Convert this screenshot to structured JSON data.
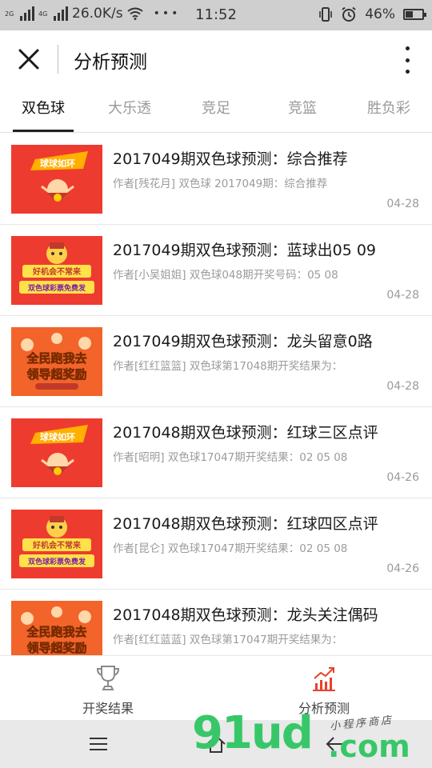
{
  "status_bar": {
    "network_type_top": "4G",
    "network_type_bottom": "2G",
    "speed": "26.0K/s",
    "dots": "•••",
    "time": "11:52",
    "battery": "46%",
    "battery_level": 0.46
  },
  "header": {
    "title": "分析预测",
    "close_icon": "close-icon",
    "more_icon": "more-vertical-icon"
  },
  "tabs": [
    {
      "label": "双色球",
      "active": true
    },
    {
      "label": "大乐透",
      "active": false
    },
    {
      "label": "竞足",
      "active": false
    },
    {
      "label": "竞篮",
      "active": false
    },
    {
      "label": "胜负彩",
      "active": false
    }
  ],
  "articles": [
    {
      "title": "2017049期双色球预测：综合推荐",
      "subtitle": "作者[残花月] 双色球 2017049期：综合推荐",
      "date": "04-28",
      "thumb": "qiuqiu",
      "thumb_text": "球球如环"
    },
    {
      "title": "2017049期双色球预测：蓝球出05 09",
      "subtitle": "作者[小吴姐姐] 双色球048期开奖号码：05 08",
      "date": "04-28",
      "thumb": "haoji",
      "thumb_text": "好机会不常来",
      "thumb_text2": "双色球彩票免费发"
    },
    {
      "title": "2017049期双色球预测：龙头留意0路",
      "subtitle": "作者[红红篮篮] 双色球第17048期开奖结果为：",
      "date": "04-28",
      "thumb": "quanmin",
      "thumb_text": "全民跑我去",
      "thumb_text2": "领导超奖励"
    },
    {
      "title": "2017048期双色球预测：红球三区点评",
      "subtitle": "作者[昭明] 双色球17047期开奖结果：02 05 08",
      "date": "04-26",
      "thumb": "qiuqiu",
      "thumb_text": "球球如环"
    },
    {
      "title": "2017048期双色球预测：红球四区点评",
      "subtitle": "作者[昆仑] 双色球17047期开奖结果：02 05 08",
      "date": "04-26",
      "thumb": "haoji",
      "thumb_text": "好机会不常来",
      "thumb_text2": "双色球彩票免费发"
    },
    {
      "title": "2017048期双色球预测：龙头关注偶码",
      "subtitle": "作者[红红蓝蓝] 双色球第17047期开奖结果为：",
      "date": "",
      "thumb": "quanmin",
      "thumb_text": "全民跑我去",
      "thumb_text2": "领导超奖励"
    }
  ],
  "bottom_nav": [
    {
      "label": "开奖结果",
      "icon": "trophy-icon",
      "active": false
    },
    {
      "label": "分析预测",
      "icon": "trend-chart-icon",
      "active": true
    }
  ],
  "system_nav": {
    "menu_icon": "menu-icon",
    "home_icon": "home-icon",
    "back_icon": "back-icon"
  },
  "watermark": {
    "logo": "91ud",
    "suffix": ".com",
    "tagline": "小程序商店"
  },
  "colors": {
    "active_icon": "#e8412c",
    "inactive_icon": "#8a8a8a",
    "thumb_red": "#ee3b2f",
    "thumb_orange": "#f2642a",
    "watermark_green": "#38c768"
  }
}
